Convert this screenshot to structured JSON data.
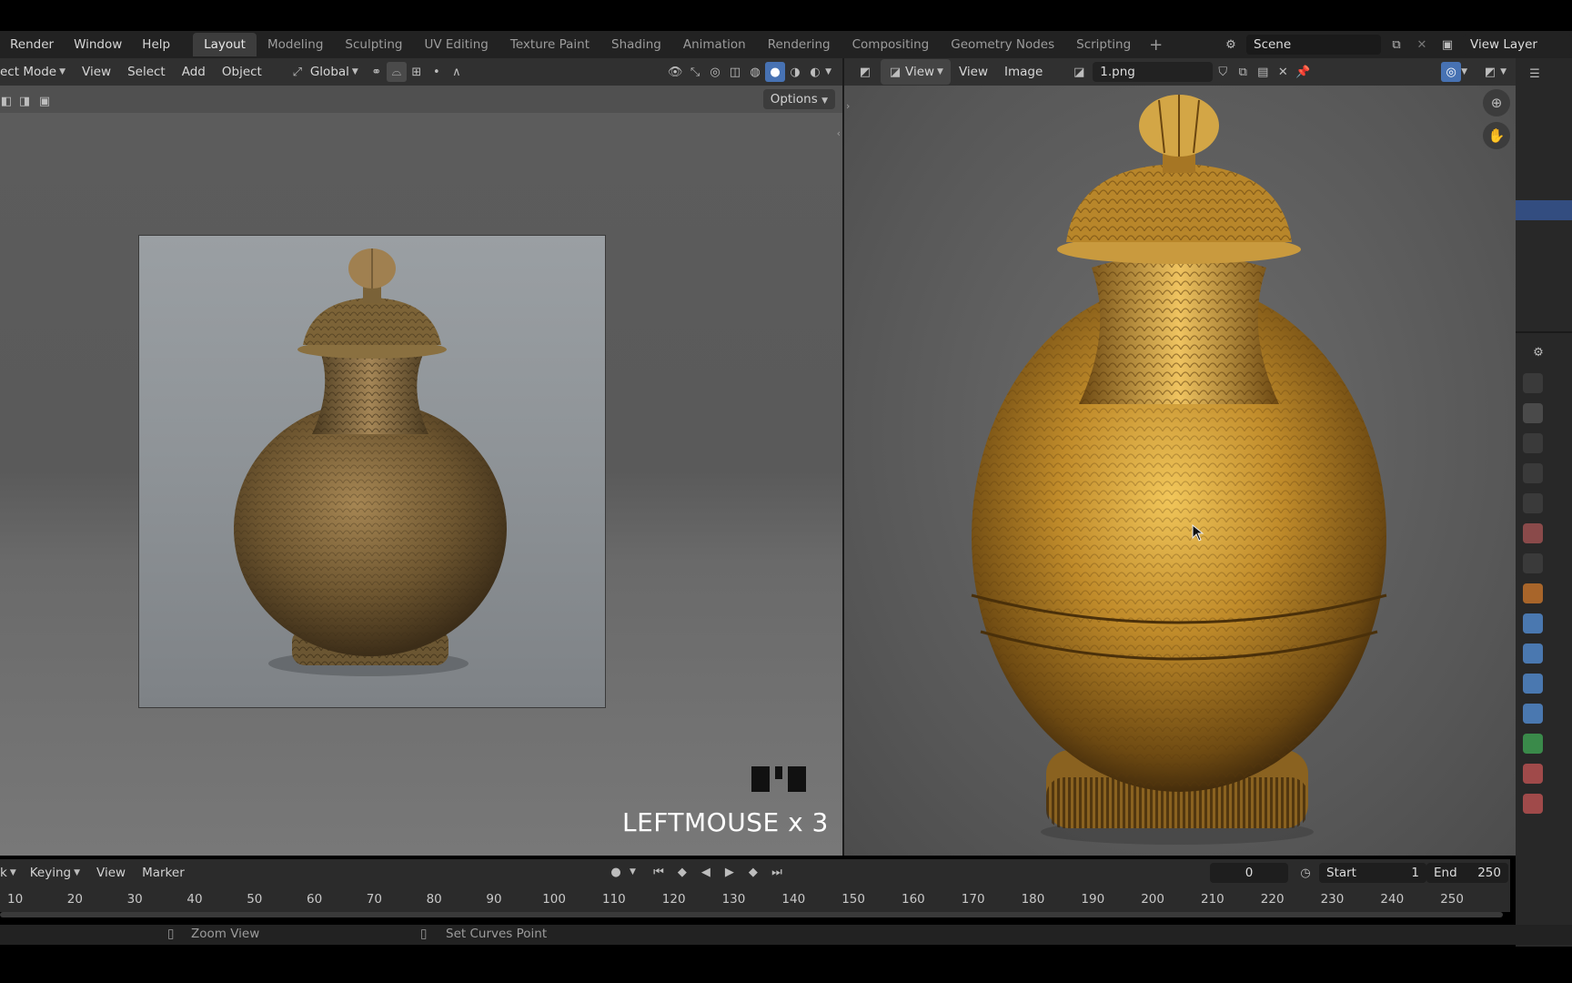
{
  "topbar": {
    "menu": [
      "Render",
      "Window",
      "Help"
    ],
    "workspaces": [
      "Layout",
      "Modeling",
      "Sculpting",
      "UV Editing",
      "Texture Paint",
      "Shading",
      "Animation",
      "Rendering",
      "Compositing",
      "Geometry Nodes",
      "Scripting"
    ],
    "active_workspace": "Layout",
    "scene": "Scene",
    "view_layer": "View Layer"
  },
  "viewport_header": {
    "mode": "ect Mode",
    "menus": [
      "View",
      "Select",
      "Add",
      "Object"
    ],
    "transform_orientation": "Global",
    "options": "Options"
  },
  "image_editor_header": {
    "view_dropdown": "View",
    "menus": [
      "View",
      "Image"
    ],
    "image_name": "1.png"
  },
  "key_overlay": "LEFTMOUSE x 3",
  "timeline": {
    "keying": "Keying",
    "menus": [
      "View",
      "Marker"
    ],
    "current_frame": "0",
    "start_label": "Start",
    "start_value": "1",
    "end_label": "End",
    "end_value": "250",
    "ruler": [
      "10",
      "20",
      "30",
      "40",
      "50",
      "60",
      "70",
      "80",
      "90",
      "100",
      "110",
      "120",
      "130",
      "140",
      "150",
      "160",
      "170",
      "180",
      "190",
      "200",
      "210",
      "220",
      "230",
      "240",
      "250"
    ],
    "left_clip": "k"
  },
  "status": {
    "left": "Zoom View",
    "right": "Set Curves Point"
  },
  "colors": {
    "active_blue": "#4772b3",
    "gold": "#b8862a"
  }
}
